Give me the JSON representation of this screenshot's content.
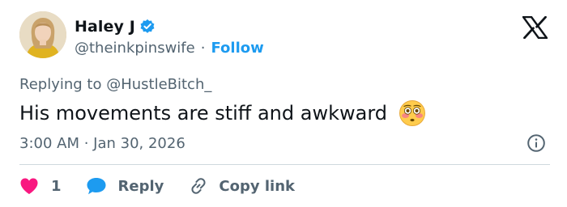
{
  "author": {
    "display_name": "Haley J",
    "handle": "@theinkpinswife",
    "separator": "·",
    "follow_label": "Follow"
  },
  "tweet": {
    "replying_to": "Replying to @HustleBitch_",
    "text": "His movements are stiff and awkward",
    "timestamp": "3:00 AM · Jan 30, 2026"
  },
  "actions": {
    "like_count": "1",
    "reply_label": "Reply",
    "copy_label": "Copy link"
  },
  "colors": {
    "text": "#0f1419",
    "secondary": "#536471",
    "accent": "#1d9bf0",
    "like": "#f91880",
    "reply_icon": "#1d9bf0",
    "divider": "#cfd9de"
  },
  "icons": {
    "verified": "verified-badge-icon",
    "logo": "x-logo-icon",
    "emoji": "flushed-face-emoji",
    "info": "info-icon",
    "like": "heart-icon",
    "reply": "speech-bubble-icon",
    "copy": "link-icon"
  }
}
